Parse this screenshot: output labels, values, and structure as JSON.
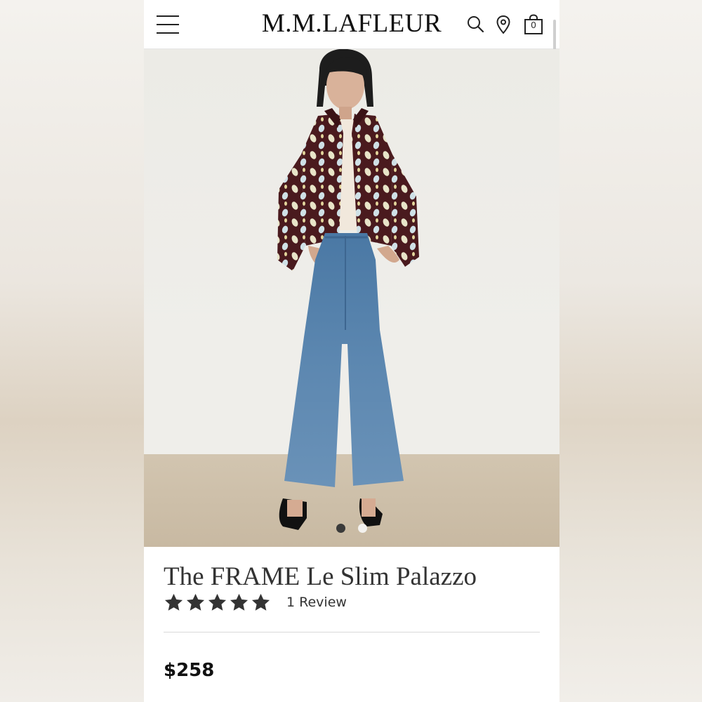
{
  "header": {
    "brand": "M.M.LAFLEUR",
    "bag_count": "0",
    "icons": [
      "menu-icon",
      "search-icon",
      "location-pin-icon",
      "shopping-bag-icon"
    ]
  },
  "gallery": {
    "image_count": 2,
    "active_index": 0
  },
  "product": {
    "title": "The FRAME Le Slim Palazzo",
    "rating": 5,
    "rating_max": 5,
    "review_label": "1 Review",
    "price": "$258"
  },
  "colors": {
    "jacket": "#4a1a1e",
    "jeans": "#4f7ba6",
    "text": "#333333"
  }
}
